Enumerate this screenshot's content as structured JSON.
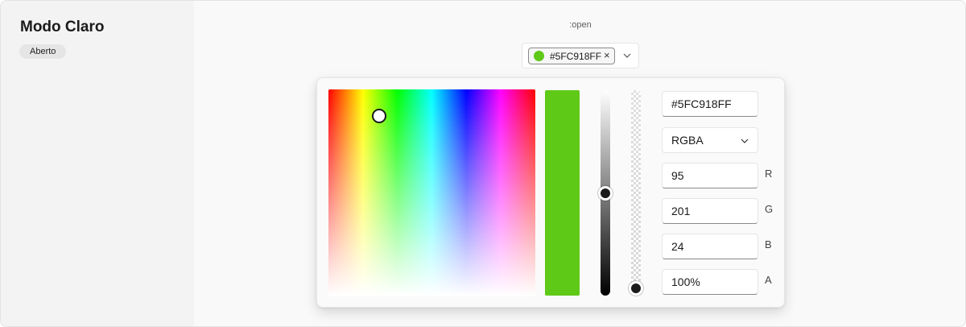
{
  "sidebar": {
    "title": "Modo Claro",
    "badge": "Aberto"
  },
  "state_label": ":open",
  "trigger": {
    "chip_text": "#5FC918FF",
    "close_glyph": "×",
    "swatch_color": "#5FC918",
    "chevron_icon": "chevron-down-icon"
  },
  "picker": {
    "selected_color": "#5FC918",
    "hex_value": "#5FC918FF",
    "mode": "RGBA",
    "channels": {
      "r": {
        "label": "R",
        "value": "95"
      },
      "g": {
        "label": "G",
        "value": "201"
      },
      "b": {
        "label": "B",
        "value": "24"
      },
      "a": {
        "label": "A",
        "value": "100%"
      }
    },
    "value_slider_level": 0.5,
    "alpha_slider_level": 1.0
  }
}
